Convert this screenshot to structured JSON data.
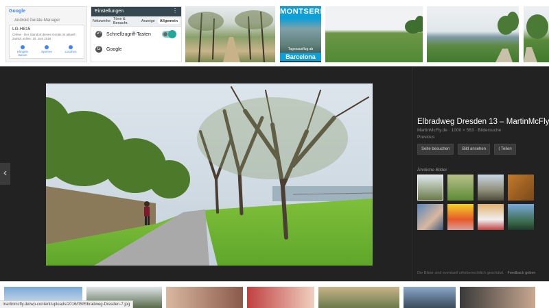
{
  "top_results": {
    "geraete_manager": {
      "brand": "Google",
      "title": "Android Geräte-Manager",
      "device": "LG-H815",
      "description": "Online · Der Standort dieses Geräts ist aktuell · Zuletzt online: 10. Juni 2016",
      "actions": [
        "Klingeln lassen",
        "Sperren",
        "Löschen"
      ]
    },
    "einstellungen": {
      "title": "Einstellungen",
      "tabs": [
        "Netzwerke",
        "Töne & Benachr.",
        "Anzeige",
        "Allgemein"
      ],
      "active_tab": "Allgemein",
      "rows": [
        {
          "icon": "shortcut-arrow-icon",
          "label": "Schnellzugriff-Tasten"
        },
        {
          "icon": "google-g-icon",
          "label": "Google"
        }
      ]
    },
    "montserrat": {
      "title": "MONTSERRAT",
      "subtitle": "Tagesausflug ab",
      "city": "Barcelona"
    }
  },
  "viewer": {
    "prev_arrow": "‹",
    "title": "Elbradweg Dresden 13 – MartinMcFly.de",
    "meta": "MartinMcFly.de · 1000 × 563 · Bildersuche",
    "previous_label": "Previous",
    "buttons": [
      {
        "icon": "none",
        "label": "Seite besuchen"
      },
      {
        "icon": "none",
        "label": "Bild ansehen"
      },
      {
        "icon": "share-icon",
        "label": "Teilen"
      }
    ],
    "similar_label": "Ähnliche Bilder",
    "similar_images": [
      "park-path",
      "bike-meadow",
      "pavilion",
      "wood-interior",
      "selfie",
      "blonde-woman",
      "cake-banner",
      "coast-town"
    ],
    "copyright_note": "Die Bilder sind eventuell urheberrechtlich geschützt.",
    "feedback_label": "Feedback geben"
  },
  "status_bar": {
    "url": "martinmcfly.de/wp-content/uploads/2016/05/Elbradweg-Dresden-7.jpg"
  },
  "colors": {
    "viewer_bg": "#222222",
    "accent_teal": "#26a69a",
    "google_blue": "#4285f4",
    "montserrat_blue": "#0e9fd6"
  }
}
